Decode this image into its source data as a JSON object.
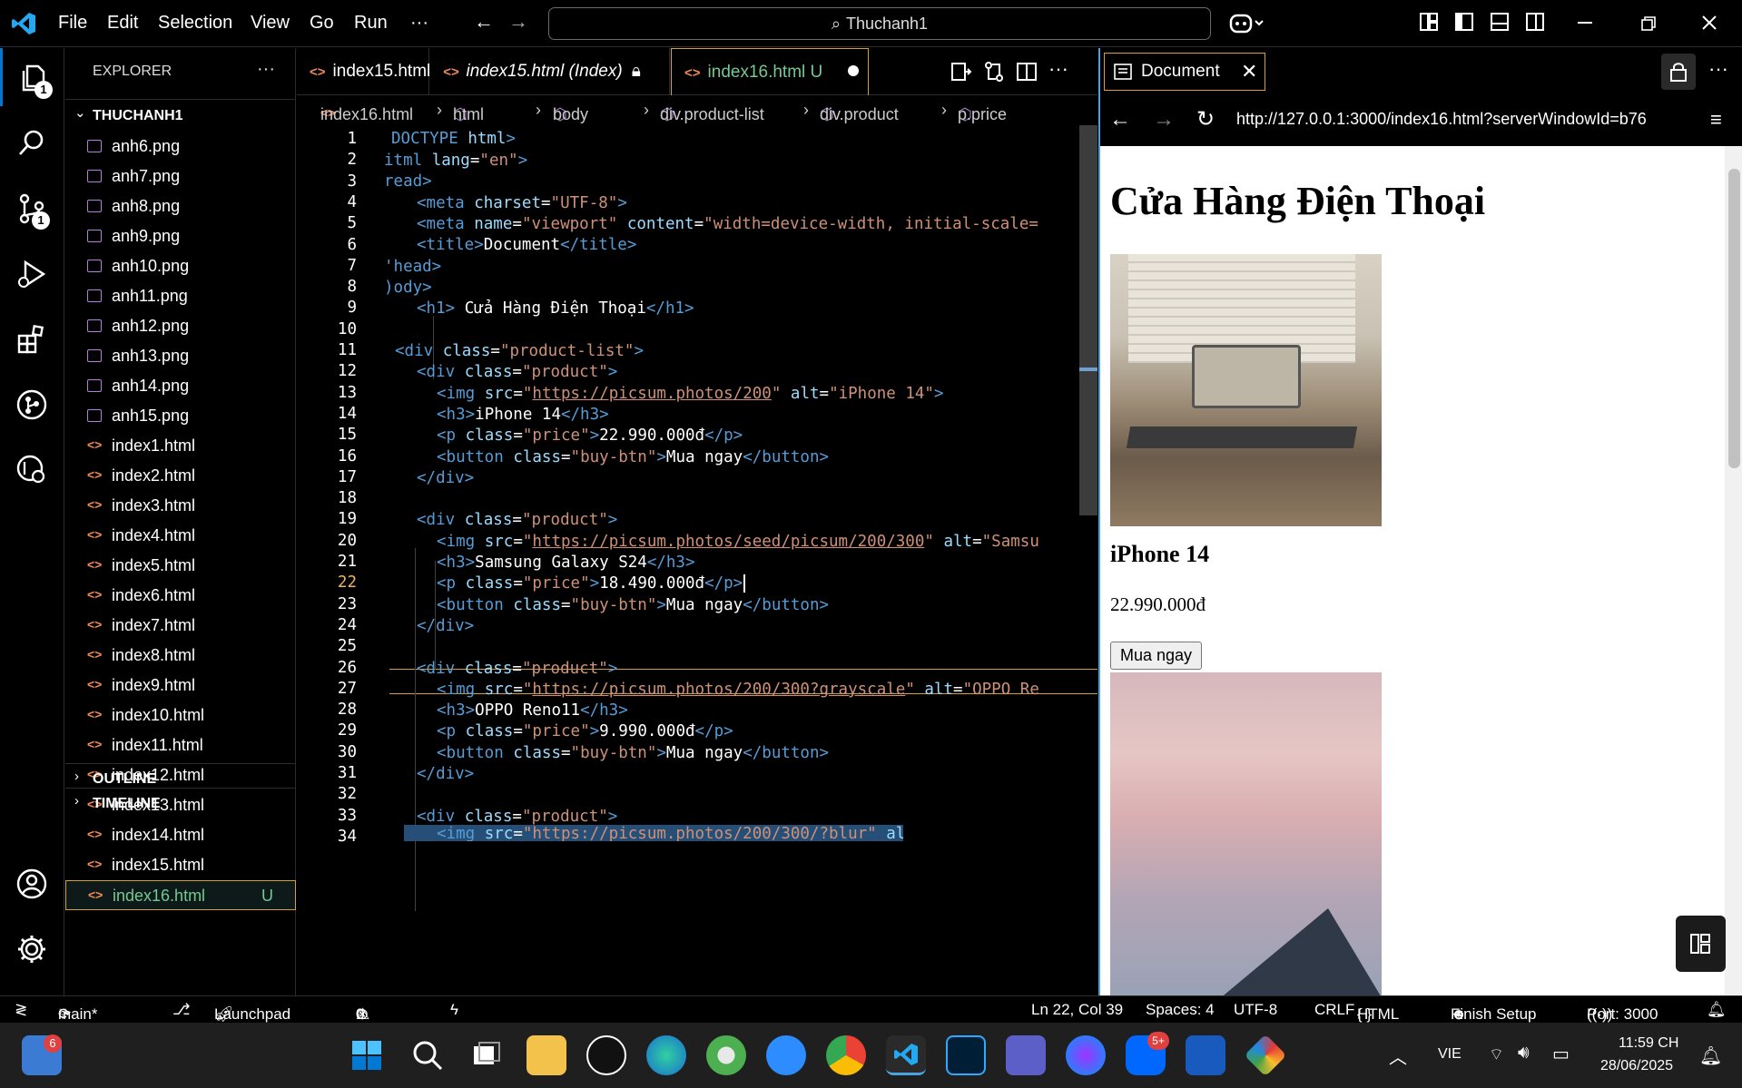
{
  "titlebar": {
    "menu": [
      "File",
      "Edit",
      "Selection",
      "View",
      "Go",
      "Run",
      "···"
    ],
    "search": "Thuchanh1"
  },
  "activity": {
    "explorer_badge": "1",
    "scm_badge": "1"
  },
  "explorer": {
    "header": "EXPLORER",
    "folder": "THUCHANH1",
    "files": [
      {
        "name": "anh6.png",
        "type": "image"
      },
      {
        "name": "anh7.png",
        "type": "image"
      },
      {
        "name": "anh8.png",
        "type": "image"
      },
      {
        "name": "anh9.png",
        "type": "image"
      },
      {
        "name": "anh10.png",
        "type": "image"
      },
      {
        "name": "anh11.png",
        "type": "image"
      },
      {
        "name": "anh12.png",
        "type": "image"
      },
      {
        "name": "anh13.png",
        "type": "image"
      },
      {
        "name": "anh14.png",
        "type": "image"
      },
      {
        "name": "anh15.png",
        "type": "image"
      },
      {
        "name": "index1.html",
        "type": "html"
      },
      {
        "name": "index2.html",
        "type": "html"
      },
      {
        "name": "index3.html",
        "type": "html"
      },
      {
        "name": "index4.html",
        "type": "html"
      },
      {
        "name": "index5.html",
        "type": "html"
      },
      {
        "name": "index6.html",
        "type": "html"
      },
      {
        "name": "index7.html",
        "type": "html"
      },
      {
        "name": "index8.html",
        "type": "html"
      },
      {
        "name": "index9.html",
        "type": "html"
      },
      {
        "name": "index10.html",
        "type": "html"
      },
      {
        "name": "index11.html",
        "type": "html"
      },
      {
        "name": "index12.html",
        "type": "html"
      },
      {
        "name": "index13.html",
        "type": "html"
      },
      {
        "name": "index14.html",
        "type": "html"
      },
      {
        "name": "index15.html",
        "type": "html"
      },
      {
        "name": "index16.html",
        "type": "html",
        "status": "U"
      }
    ],
    "outline": "OUTLINE",
    "timeline": "TIMELINE"
  },
  "tabs": [
    {
      "label": "index15.html"
    },
    {
      "label": "index15.html (Index)"
    },
    {
      "label": "index16.html",
      "status": "U"
    }
  ],
  "breadcrumb": [
    "index16.html",
    "html",
    "body",
    "div.product-list",
    "div.product",
    "p.price"
  ],
  "code": {
    "line_numbers": [
      "1",
      "2",
      "3",
      "4",
      "5",
      "6",
      "7",
      "8",
      "9",
      "10",
      "11",
      "12",
      "13",
      "14",
      "15",
      "16",
      "17",
      "18",
      "19",
      "20",
      "21",
      "22",
      "23",
      "24",
      "25",
      "26",
      "27",
      "28",
      "29",
      "30",
      "31",
      "32",
      "33",
      "34"
    ],
    "current_line": "22"
  },
  "browser": {
    "tab_title": "Document",
    "url": "http://127.0.0.1:3000/index16.html?serverWindowId=b76",
    "page": {
      "heading": "Cửa Hàng Điện Thoại",
      "products": [
        {
          "name": "iPhone 14",
          "price": "22.990.000đ",
          "button": "Mua ngay"
        }
      ]
    }
  },
  "statusbar": {
    "branch": "main*",
    "launchpad": "Launchpad",
    "errors": "0",
    "warnings": "0",
    "position": "Ln 22, Col 39",
    "spaces": "Spaces: 4",
    "encoding": "UTF-8",
    "eol": "CRLF",
    "language": "HTML",
    "finish_setup": "Finish Setup",
    "port": "Port: 3000"
  },
  "taskbar": {
    "notification_badge": "6",
    "zalo_badge": "5+",
    "language": "VIE",
    "time": "11:59 CH",
    "date": "28/06/2025"
  },
  "colors": {
    "accent": "#0078d4",
    "tab_border": "#d4a03a",
    "untracked": "#73c991",
    "html_icon": "#f28b54"
  }
}
